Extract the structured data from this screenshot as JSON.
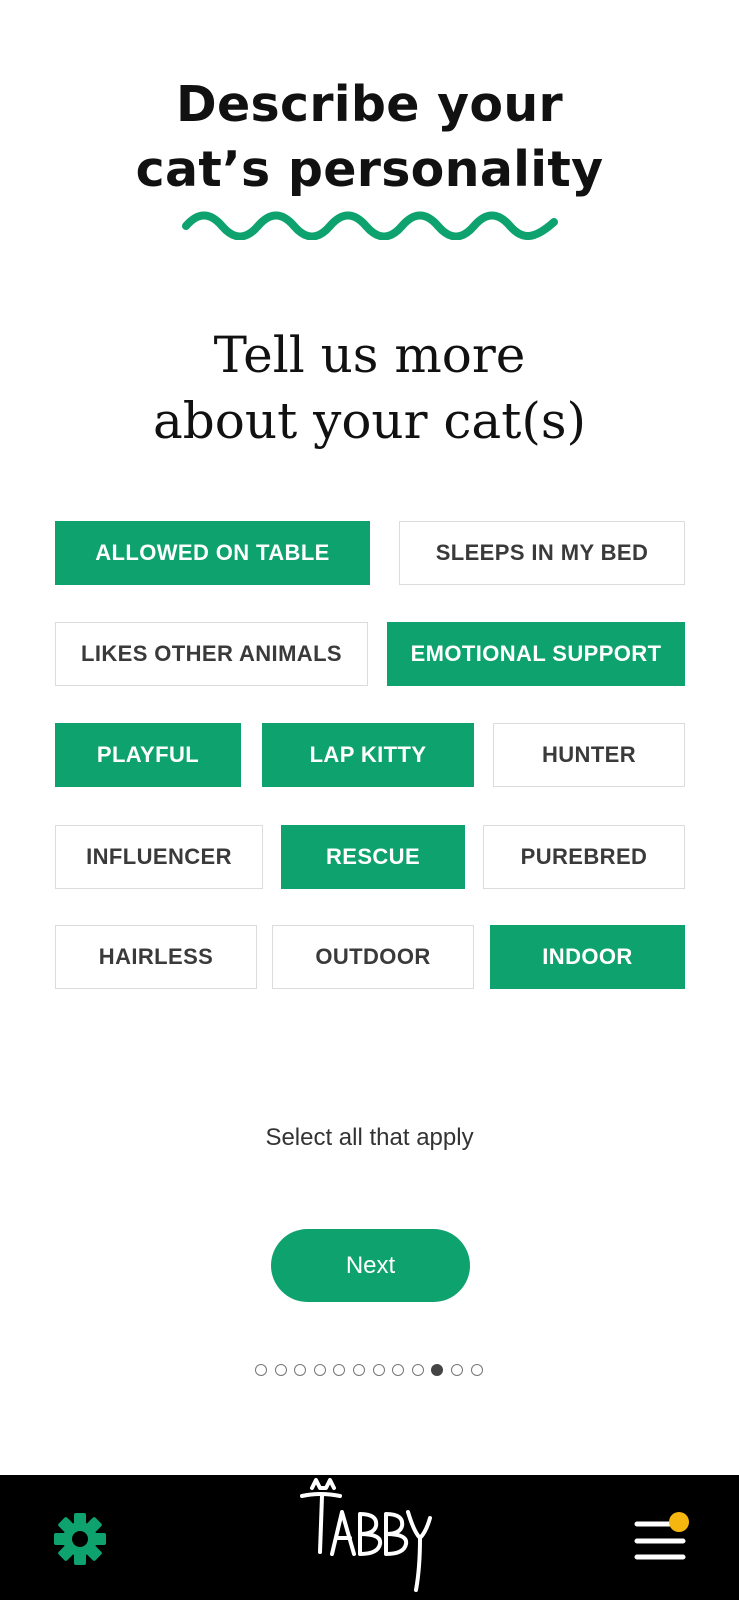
{
  "heading": {
    "line1": "Describe your",
    "line2": "cat’s personality"
  },
  "subheading": {
    "line1": "Tell us more",
    "line2": "about your cat(s)"
  },
  "tags": [
    {
      "label": "ALLOWED ON TABLE",
      "selected": true
    },
    {
      "label": "SLEEPS IN MY BED",
      "selected": false
    },
    {
      "label": "LIKES OTHER ANIMALS",
      "selected": false
    },
    {
      "label": "EMOTIONAL SUPPORT",
      "selected": true
    },
    {
      "label": "PLAYFUL",
      "selected": true
    },
    {
      "label": "LAP KITTY",
      "selected": true
    },
    {
      "label": "HUNTER",
      "selected": false
    },
    {
      "label": "INFLUENCER",
      "selected": false
    },
    {
      "label": "RESCUE",
      "selected": true
    },
    {
      "label": "PUREBRED",
      "selected": false
    },
    {
      "label": "HAIRLESS",
      "selected": false
    },
    {
      "label": "OUTDOOR",
      "selected": false
    },
    {
      "label": "INDOOR",
      "selected": true
    }
  ],
  "hint": "Select all that apply",
  "next_label": "Next",
  "pagination": {
    "total": 12,
    "current": 10
  },
  "bottom_nav": {
    "settings_icon": "gear-icon",
    "logo_text": "TABBY",
    "menu_icon": "hamburger-menu-icon",
    "notification_badge": true
  },
  "colors": {
    "accent": "#0ea26f",
    "badge": "#f5b70f",
    "bar": "#000000"
  }
}
